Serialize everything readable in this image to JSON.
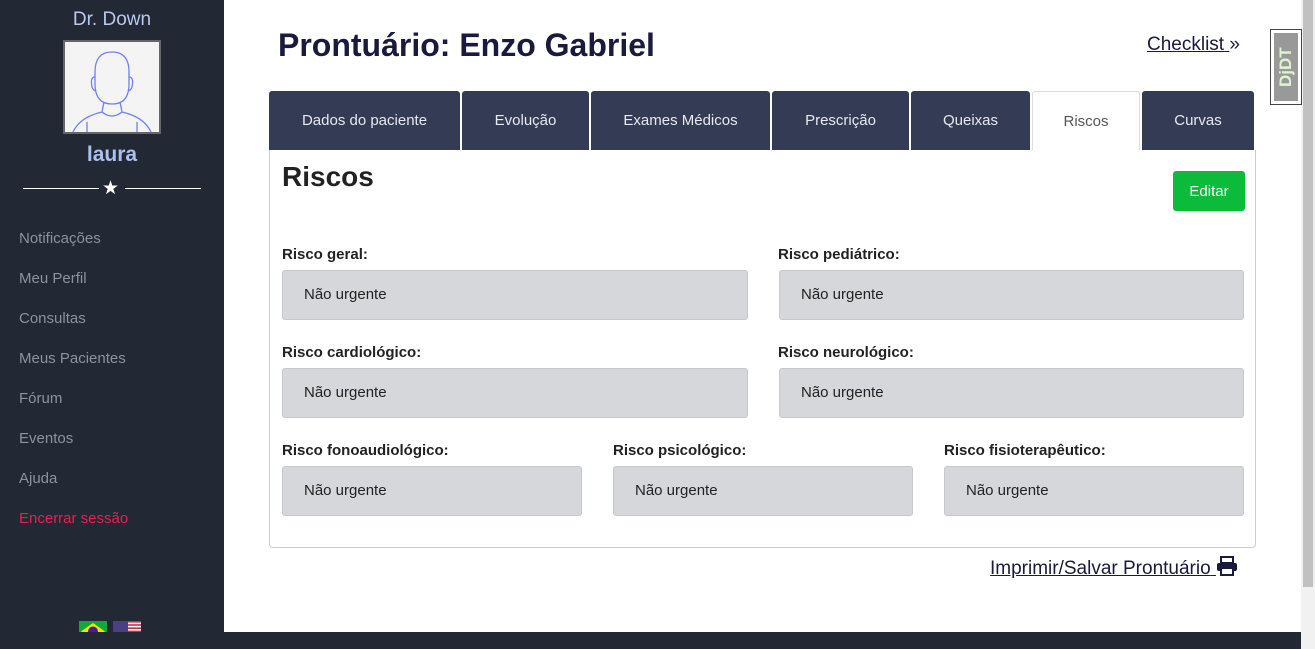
{
  "sidebar": {
    "brand": "Dr. Down",
    "username": "laura",
    "items": [
      {
        "label": "Notificações"
      },
      {
        "label": "Meu Perfil"
      },
      {
        "label": "Consultas"
      },
      {
        "label": "Meus Pacientes"
      },
      {
        "label": "Fórum"
      },
      {
        "label": "Eventos"
      },
      {
        "label": "Ajuda"
      },
      {
        "label": "Encerrar sessão"
      }
    ]
  },
  "header": {
    "title": "Prontuário: Enzo Gabriel",
    "checklist": "Checklist",
    "ddt": "DjDT"
  },
  "tabs": [
    {
      "label": "Dados do paciente"
    },
    {
      "label": "Evolução"
    },
    {
      "label": "Exames Médicos"
    },
    {
      "label": "Prescrição"
    },
    {
      "label": "Queixas"
    },
    {
      "label": "Riscos"
    },
    {
      "label": "Curvas"
    }
  ],
  "panel": {
    "title": "Riscos",
    "edit": "Editar",
    "fields": [
      {
        "label": "Risco geral:",
        "value": "Não urgente"
      },
      {
        "label": "Risco pediátrico:",
        "value": "Não urgente"
      },
      {
        "label": "Risco cardiológico:",
        "value": "Não urgente"
      },
      {
        "label": "Risco neurológico:",
        "value": "Não urgente"
      },
      {
        "label": "Risco fonoaudiológico:",
        "value": "Não urgente"
      },
      {
        "label": "Risco psicológico:",
        "value": "Não urgente"
      },
      {
        "label": "Risco fisioterapêutico:",
        "value": "Não urgente"
      }
    ]
  },
  "footer": {
    "print": "Imprimir/Salvar Prontuário"
  },
  "colors": {
    "sidebar": "#222834",
    "tab": "#343b55",
    "edit": "#0dbb3a",
    "logout": "#e8204f"
  }
}
